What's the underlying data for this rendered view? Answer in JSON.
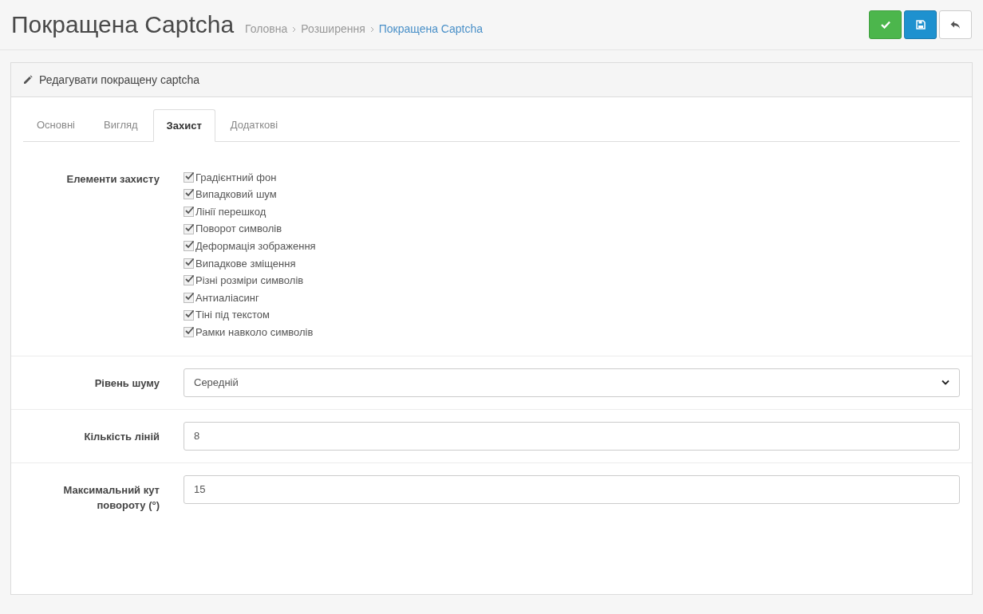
{
  "page": {
    "title": "Покращена Captcha",
    "breadcrumbs": [
      {
        "label": "Головна",
        "current": false
      },
      {
        "label": "Розширення",
        "current": false
      },
      {
        "label": "Покращена Captcha",
        "current": true
      }
    ]
  },
  "toolbar": {
    "buttons": [
      {
        "kind": "save_close"
      },
      {
        "kind": "save"
      },
      {
        "kind": "back"
      }
    ]
  },
  "panel": {
    "heading": "Редагувати покращену captcha",
    "tabs": [
      {
        "label": "Основні",
        "selected": false
      },
      {
        "label": "Вигляд",
        "selected": false
      },
      {
        "label": "Захист",
        "selected": true
      },
      {
        "label": "Додаткові",
        "selected": false
      }
    ],
    "rows": [
      {
        "kind": "checkboxes",
        "label": "Елементи захисту",
        "options": [
          {
            "label": "Градієнтний фон",
            "checked": true
          },
          {
            "label": "Випадковий шум",
            "checked": true
          },
          {
            "label": "Лінії перешкод",
            "checked": true
          },
          {
            "label": "Поворот символів",
            "checked": true
          },
          {
            "label": "Деформація зображення",
            "checked": true
          },
          {
            "label": "Випадкове зміщення",
            "checked": true
          },
          {
            "label": "Різні розміри символів",
            "checked": true
          },
          {
            "label": "Антиаліасинг",
            "checked": true
          },
          {
            "label": "Тіні під текстом",
            "checked": true
          },
          {
            "label": "Рамки навколо символів",
            "checked": true
          }
        ]
      },
      {
        "kind": "select",
        "label": "Рівень шуму",
        "value": "Середній"
      },
      {
        "kind": "input",
        "label": "Кількість ліній",
        "value": "8"
      },
      {
        "kind": "input",
        "label": "Максимальний кут повороту (°)",
        "value": "15"
      }
    ]
  }
}
